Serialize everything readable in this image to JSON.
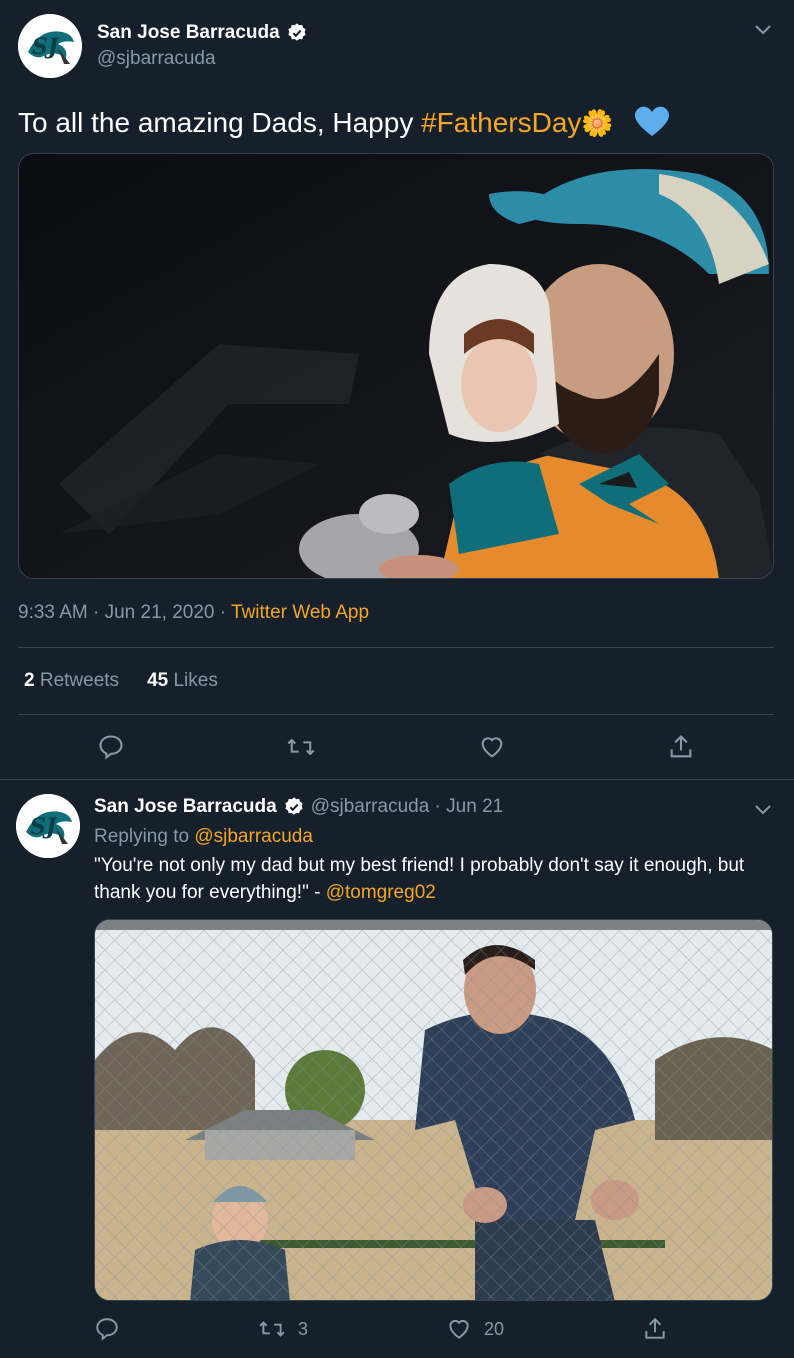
{
  "main_tweet": {
    "author_name": "San Jose Barracuda",
    "author_handle": "@sjbarracuda",
    "text_prefix": "To all the amazing Dads, Happy ",
    "hashtag": "#FathersDay",
    "emoji_rose": "🌼",
    "emoji_heart": "💙",
    "time": "9:33 AM · Jun 21, 2020 · ",
    "source": "Twitter Web App",
    "retweets_count": "2",
    "retweets_label": "Retweets",
    "likes_count": "45",
    "likes_label": "Likes",
    "image_alt": "Father in a cap holding a young child at a game"
  },
  "reply_tweet": {
    "author_name": "San Jose Barracuda",
    "author_handle": "@sjbarracuda",
    "date_sep": " · ",
    "date": "Jun 21",
    "replying_label": "Replying to ",
    "replying_handle": "@sjbarracuda",
    "text": "\"You're not only my dad but my best friend! I probably don't say it enough, but thank you for everything!\" - ",
    "mention": "@tomgreg02",
    "retweets_count": "3",
    "likes_count": "20",
    "image_alt": "Father leaning over a toddler by a chain-link fence"
  },
  "colors": {
    "background": "#15202b",
    "accent": "#f5a623",
    "muted": "#8899a6",
    "divider": "#38444d",
    "verified": "#ffffff"
  },
  "icons": [
    "chevron-down-icon",
    "verified-badge-icon",
    "reply-icon",
    "retweet-icon",
    "like-icon",
    "share-icon"
  ]
}
